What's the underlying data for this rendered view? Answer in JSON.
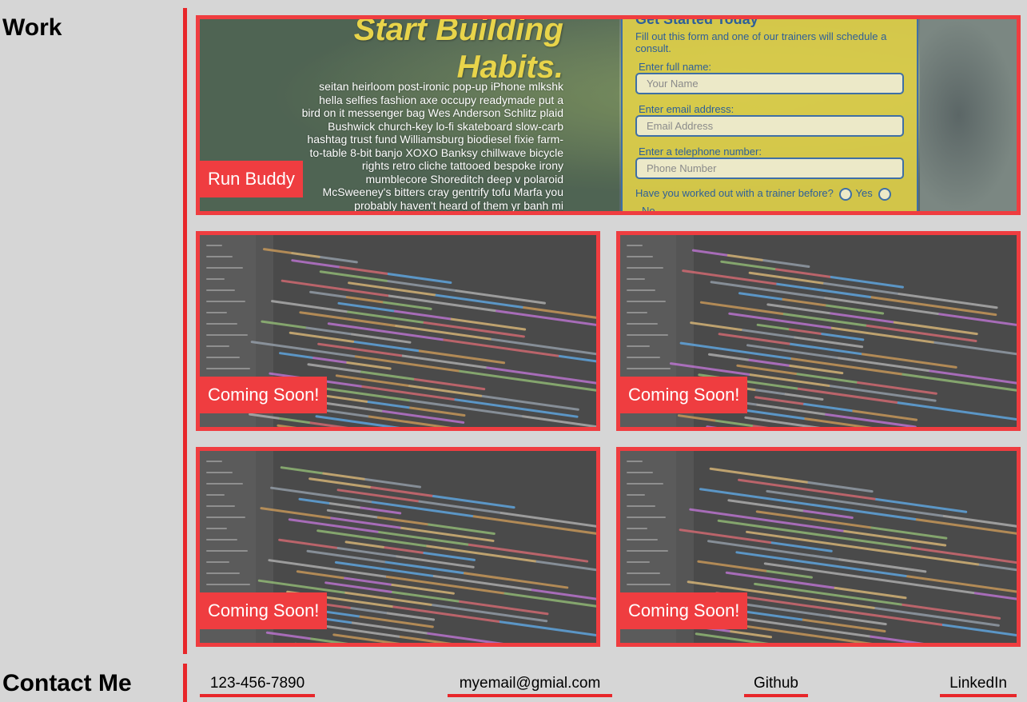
{
  "sections": {
    "work_title": "Work",
    "contact_title": "Contact Me"
  },
  "featured_project": {
    "label": "Run Buddy",
    "headline_line1": "Start Building",
    "headline_line2": "Habits.",
    "body_text": "seitan heirloom post-ironic pop-up iPhone mlkshk hella selfies fashion axe occupy readymade put a bird on it messenger bag Wes Anderson Schlitz plaid Bushwick church-key lo-fi skateboard slow-carb hashtag trust fund Williamsburg biodiesel fixie farm-to-table 8-bit banjo XOXO Banksy chillwave bicycle rights retro cliche tattooed bespoke irony mumblecore Shoreditch deep v polaroid McSweeney's bitters cray gentrify tofu Marfa you probably haven't heard of them yr banh mi",
    "form": {
      "title": "Get Started Today",
      "intro": "Fill out this form and one of our trainers will schedule a consult.",
      "name_label": "Enter full name:",
      "name_placeholder": "Your Name",
      "email_label": "Enter email address:",
      "email_placeholder": "Email Address",
      "phone_label": "Enter a telephone number:",
      "phone_placeholder": "Phone Number",
      "question": "Have you worked out with a trainer before?",
      "option_yes": "Yes",
      "option_no": "No"
    }
  },
  "projects": [
    {
      "label": "Coming Soon!"
    },
    {
      "label": "Coming Soon!"
    },
    {
      "label": "Coming Soon!"
    },
    {
      "label": "Coming Soon!"
    }
  ],
  "contact": {
    "phone": "123-456-7890",
    "email": "myemail@gmial.com",
    "github": "Github",
    "linkedin": "LinkedIn"
  },
  "colors": {
    "accent": "#ef3d40",
    "background": "#d6d6d6",
    "divider": "#e8262a"
  }
}
